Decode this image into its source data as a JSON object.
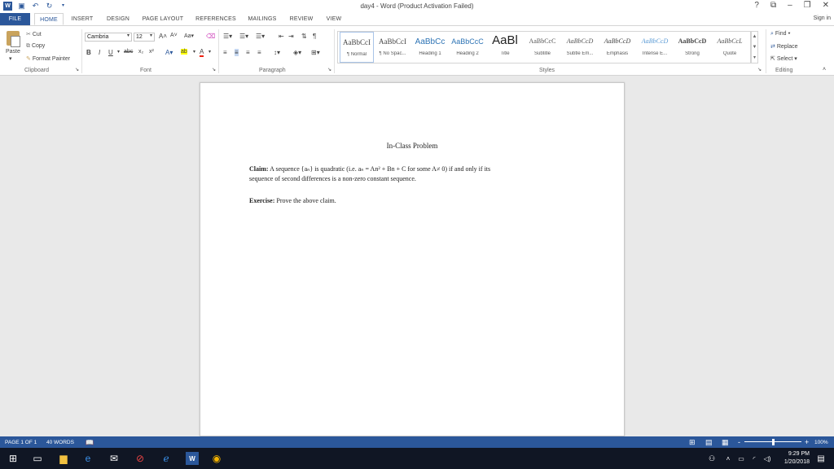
{
  "window": {
    "title": "day4 - Word (Product Activation Failed)",
    "help": "?",
    "ribbon_display": "⧉",
    "minimize": "–",
    "restore": "❐",
    "close": "✕"
  },
  "tabs": [
    {
      "label": "FILE"
    },
    {
      "label": "HOME"
    },
    {
      "label": "INSERT"
    },
    {
      "label": "DESIGN"
    },
    {
      "label": "PAGE LAYOUT"
    },
    {
      "label": "REFERENCES"
    },
    {
      "label": "MAILINGS"
    },
    {
      "label": "REVIEW"
    },
    {
      "label": "VIEW"
    }
  ],
  "signin": "Sign in",
  "clipboard": {
    "paste": "Paste",
    "cut": "Cut",
    "copy": "Copy",
    "format_painter": "Format Painter",
    "label": "Clipboard"
  },
  "font": {
    "family": "Cambria",
    "size": "12",
    "label": "Font"
  },
  "paragraph": {
    "label": "Paragraph"
  },
  "styles": {
    "label": "Styles",
    "items": [
      {
        "preview": "AaBbCcI",
        "name": "¶ Normal"
      },
      {
        "preview": "AaBbCcI",
        "name": "¶ No Spac..."
      },
      {
        "preview": "AaBbCc",
        "name": "Heading 1"
      },
      {
        "preview": "AaBbCcC",
        "name": "Heading 2"
      },
      {
        "preview": "AaBl",
        "name": "Title"
      },
      {
        "preview": "AaBbCcC",
        "name": "Subtitle"
      },
      {
        "preview": "AaBbCcD",
        "name": "Subtle Em..."
      },
      {
        "preview": "AaBbCcD",
        "name": "Emphasis"
      },
      {
        "preview": "AaBbCcD",
        "name": "Intense E..."
      },
      {
        "preview": "AaBbCcD",
        "name": "Strong"
      },
      {
        "preview": "AaBbCcL",
        "name": "Quote"
      }
    ]
  },
  "editing": {
    "find": "Find",
    "replace": "Replace",
    "select": "Select",
    "label": "Editing"
  },
  "document": {
    "heading": "In-Class Problem",
    "claim_label": "Claim:",
    "claim_text_1": "A sequence {aₙ} is quadratic (i.e. aₙ = An² + Bn + C for some A≠ 0) if and only if its",
    "claim_text_2": "sequence of second differences is a non-zero constant sequence.",
    "exercise_label": "Exercise:",
    "exercise_text": "Prove the above claim."
  },
  "status": {
    "page": "PAGE 1 OF 1",
    "words": "40 WORDS",
    "zoom": "100%",
    "zoom_minus": "-",
    "zoom_plus": "+"
  },
  "taskbar": {
    "time": "9:29 PM",
    "date": "1/20/2018"
  },
  "colors": {
    "accent": "#2b579a",
    "taskbar": "#101624"
  }
}
